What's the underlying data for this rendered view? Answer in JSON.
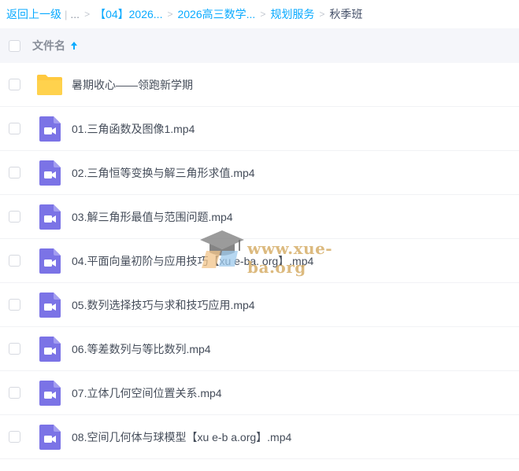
{
  "breadcrumb": {
    "back_label": "返回上一级",
    "pipe": "|",
    "ellipsis": "...",
    "crumbs": [
      "【04】2026...",
      "2026高三数学...",
      "规划服务"
    ],
    "current": "秋季班",
    "separator": ">"
  },
  "header": {
    "column_label": "文件名",
    "sort_direction": "ascending"
  },
  "files": [
    {
      "name": "暑期收心——领跑新学期",
      "type": "folder"
    },
    {
      "name": "01.三角函数及图像1.mp4",
      "type": "video"
    },
    {
      "name": "02.三角恒等变换与解三角形求值.mp4",
      "type": "video"
    },
    {
      "name": "03.解三角形最值与范围问题.mp4",
      "type": "video"
    },
    {
      "name": "04.平面向量初阶与应用技巧【xu e-ba. org】.mp4",
      "type": "video"
    },
    {
      "name": "05.数列选择技巧与求和技巧应用.mp4",
      "type": "video"
    },
    {
      "name": "06.等差数列与等比数列.mp4",
      "type": "video"
    },
    {
      "name": "07.立体几何空间位置关系.mp4",
      "type": "video"
    },
    {
      "name": "08.空间几何体与球模型【xu e-b a.org】.mp4",
      "type": "video"
    }
  ],
  "watermark": {
    "text": "www.xue-ba.org",
    "icon": "graduation-cap-icon"
  },
  "colors": {
    "link": "#09aaff",
    "folder": "#ffd24d",
    "video": "#7b73e6",
    "header_bg": "#f5f6fa"
  }
}
